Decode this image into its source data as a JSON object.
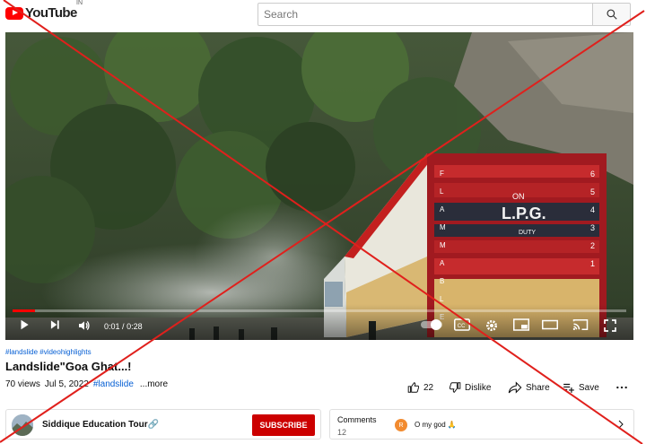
{
  "header": {
    "logo_text": "YouTube",
    "country_code": "IN",
    "search_placeholder": "Search"
  },
  "player": {
    "current_time": "0:01",
    "duration": "0:28",
    "progress": 0.036,
    "truck_text": {
      "on": "ON",
      "lpg": "L.P.G.",
      "duty": "DUTY",
      "side_letters": [
        "F",
        "L",
        "A",
        "M",
        "M",
        "A",
        "B",
        "L",
        "E"
      ],
      "side_numbers": [
        "6",
        "5",
        "4",
        "3",
        "2",
        "1"
      ]
    }
  },
  "video": {
    "hashtags": "#landslide #videohighlights",
    "title": "Landslide\"Goa Ghat...!",
    "views": "70 views",
    "date": "Jul 5, 2022",
    "inline_tag": "#landslide",
    "more": "...more"
  },
  "actions": {
    "likes": "22",
    "dislike": "Dislike",
    "share": "Share",
    "save": "Save"
  },
  "channel": {
    "name": "Siddique Education Tour🔗",
    "subscribe": "SUBSCRIBE"
  },
  "comments": {
    "label": "Comments",
    "count": "12",
    "avatar_letter": "R",
    "preview": "O my god 🙏"
  },
  "colors": {
    "brand_red": "#ff0000",
    "subscribe_red": "#cc0000",
    "link_blue": "#065fd4",
    "overlay_red": "#e0201c"
  }
}
